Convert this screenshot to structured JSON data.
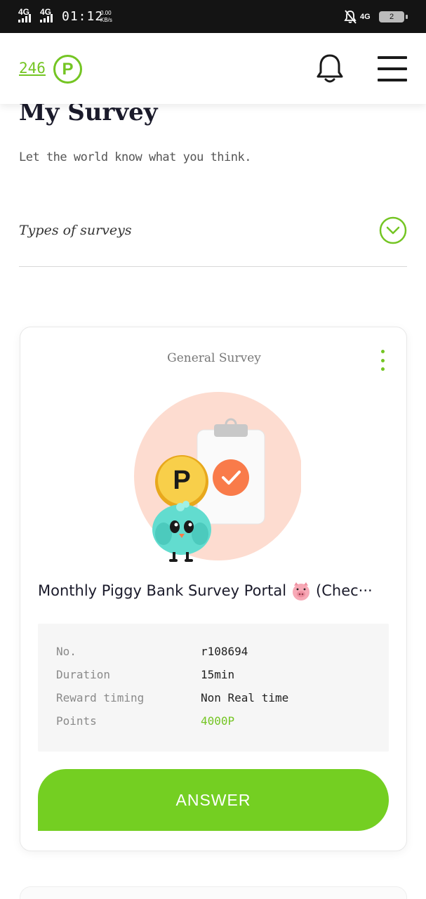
{
  "status_bar": {
    "signal1": "4G",
    "signal2": "4G",
    "time": "01:12",
    "speed_value": "0.00",
    "speed_unit": "KB/s",
    "network": "4G",
    "battery": "2"
  },
  "header": {
    "points": "246",
    "points_badge": "P",
    "icons": [
      "bell-icon",
      "menu-icon"
    ]
  },
  "page": {
    "title": "My Survey",
    "subtitle": "Let the world know what you think.",
    "types_label": "Types of surveys"
  },
  "survey_card": {
    "category": "General Survey",
    "title": "Monthly Piggy Bank Survey Portal",
    "title_suffix": "(Chec···",
    "details": [
      {
        "label": "No.",
        "value": "r108694"
      },
      {
        "label": "Duration",
        "value": "15min"
      },
      {
        "label": "Reward timing",
        "value": "Non Real time"
      },
      {
        "label": "Points",
        "value": "4000P"
      }
    ],
    "answer_label": "ANSWER"
  },
  "colors": {
    "accent": "#74c523",
    "button": "#74cf22",
    "illustration_circle": "#fddcd0",
    "check_orange": "#f97b4a"
  }
}
